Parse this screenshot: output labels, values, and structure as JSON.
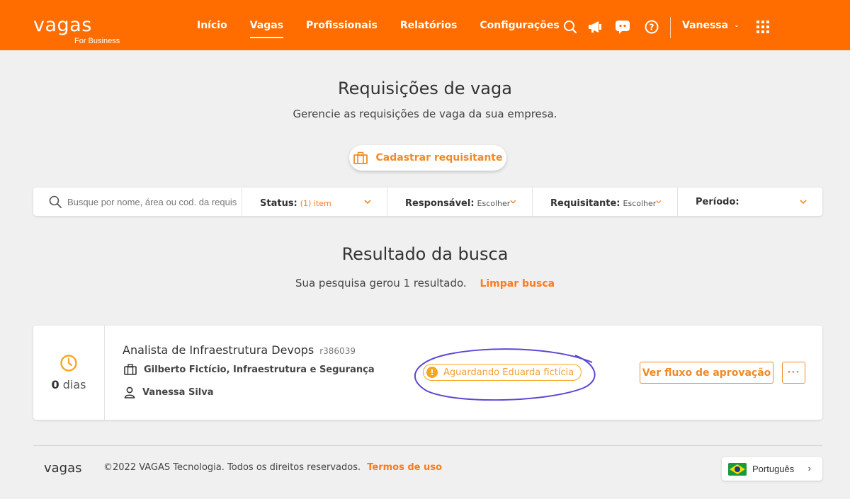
{
  "header": {
    "logo": "vagas",
    "logo_sub": "For Business",
    "nav": [
      {
        "label": "Início"
      },
      {
        "label": "Vagas"
      },
      {
        "label": "Profissionais"
      },
      {
        "label": "Relatórios"
      },
      {
        "label": "Configurações"
      }
    ],
    "active_nav": "Vagas",
    "icons": [
      "search-icon",
      "megaphone-icon",
      "chat-icon",
      "help-icon",
      "apps-grid-icon"
    ],
    "user_name": "Vanessa",
    "brand_color": "#ff6d00"
  },
  "page": {
    "title": "Requisições de vaga",
    "subtitle": "Gerencie as requisições de vaga da sua empresa.",
    "register_button": "Cadastrar requisitante"
  },
  "filters": {
    "search_placeholder": "Busque por nome, área ou cod. da requisição",
    "status_label": "Status:",
    "status_value": "(1) item",
    "responsavel_label": "Responsável:",
    "responsavel_value": "Escolher",
    "requisitante_label": "Requisitante:",
    "requisitante_value": "Escolher",
    "periodo_label": "Período:"
  },
  "results": {
    "title": "Resultado da busca",
    "summary": "Sua pesquisa gerou 1 resultado.",
    "clear_label": "Limpar busca"
  },
  "card": {
    "days_count": "0",
    "days_unit": "dias",
    "job_title": "Analista de Infraestrutura Devops",
    "job_code": "r386039",
    "requester_area": "Gilberto Fictício, Infraestrutura e Segurança",
    "owner": "Vanessa Silva",
    "status_text": "Aguardando Eduarda fictícia",
    "flow_button": "Ver fluxo de aprovação",
    "more_button": "···"
  },
  "footer": {
    "logo": "vagas",
    "copyright": "©2022 VAGAS Tecnologia. Todos os direitos reservados.",
    "terms": "Termos de uso",
    "language": "Português"
  }
}
